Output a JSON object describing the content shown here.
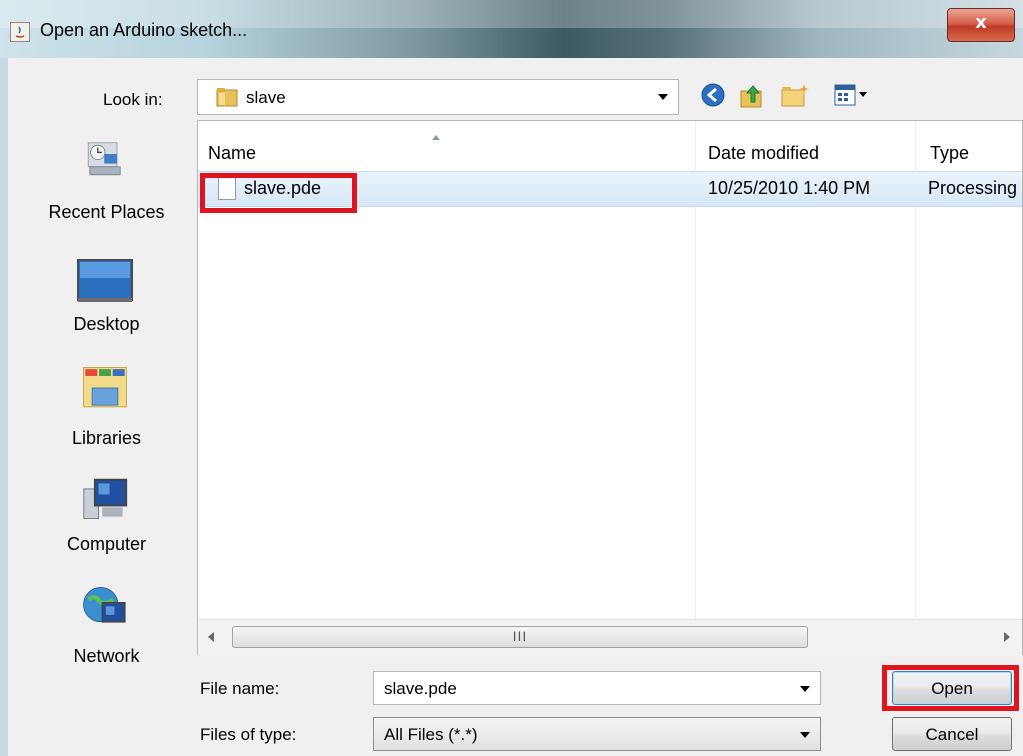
{
  "window": {
    "title": "Open an Arduino sketch...",
    "close_glyph": "x"
  },
  "toolbar": {
    "look_in_label": "Look in:",
    "look_in_value": "slave",
    "icons": [
      "back-icon",
      "up-folder-icon",
      "new-folder-icon",
      "view-menu-icon"
    ]
  },
  "places": [
    {
      "label": "Recent Places",
      "icon": "recent-places-icon"
    },
    {
      "label": "Desktop",
      "icon": "desktop-icon"
    },
    {
      "label": "Libraries",
      "icon": "libraries-icon"
    },
    {
      "label": "Computer",
      "icon": "computer-icon"
    },
    {
      "label": "Network",
      "icon": "network-icon"
    }
  ],
  "filelist": {
    "columns": [
      "Name",
      "Date modified",
      "Type"
    ],
    "rows": [
      {
        "name": "slave.pde",
        "date": "10/25/2010 1:40 PM",
        "type": "Processing"
      }
    ],
    "scroll_grip": "III"
  },
  "bottom": {
    "file_name_label": "File name:",
    "file_name_value": "slave.pde",
    "file_type_label": "Files of type:",
    "file_type_value": "All Files (*.*)",
    "open_label": "Open",
    "cancel_label": "Cancel"
  },
  "colors": {
    "highlight": "#e0141f",
    "selection": "#d6e8f7"
  }
}
